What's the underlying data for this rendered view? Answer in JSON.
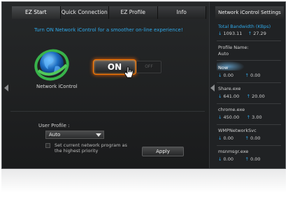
{
  "tabs": [
    {
      "label": "EZ Start"
    },
    {
      "label": "Quick Connection"
    },
    {
      "label": "EZ Profile"
    },
    {
      "label": "Info"
    }
  ],
  "main": {
    "headline": "Turn ON Network iControl for a smoother on-line experience!",
    "globe_label": "Network iControl",
    "toggle": {
      "on_label": "ON",
      "off_label": "OFF"
    },
    "profile": {
      "label": "User Profile :",
      "selected": "Auto",
      "checkbox_text": "Set current network program as the highest priority",
      "apply_label": "Apply"
    }
  },
  "side": {
    "title": "Network iControl Settings",
    "total": {
      "label": "Total Bandwidth (KBps)",
      "down": "1093.11",
      "up": "27.29"
    },
    "profile_name_label": "Profile Name:",
    "profile_name_value": "Auto",
    "items": [
      {
        "name": "Now",
        "down": "0.00",
        "up": "0.00"
      },
      {
        "name": "Share.exe",
        "down": "641.00",
        "up": "20.00"
      },
      {
        "name": "chrome.exe",
        "down": "450.00",
        "up": "3.00"
      },
      {
        "name": "WMPNetworkSvc",
        "down": "0.00",
        "up": "0.00"
      },
      {
        "name": "msnmsgr.exe",
        "down": "0.00",
        "up": "0.00"
      }
    ]
  },
  "colors": {
    "accent": "#2fa8e8",
    "toggle_glow": "#ff7a00",
    "background": "#1b1d1f"
  },
  "icons": [
    "globe-icon",
    "cursor-icon",
    "left-arrow-icon",
    "down-arrow-icon",
    "up-arrow-icon"
  ]
}
